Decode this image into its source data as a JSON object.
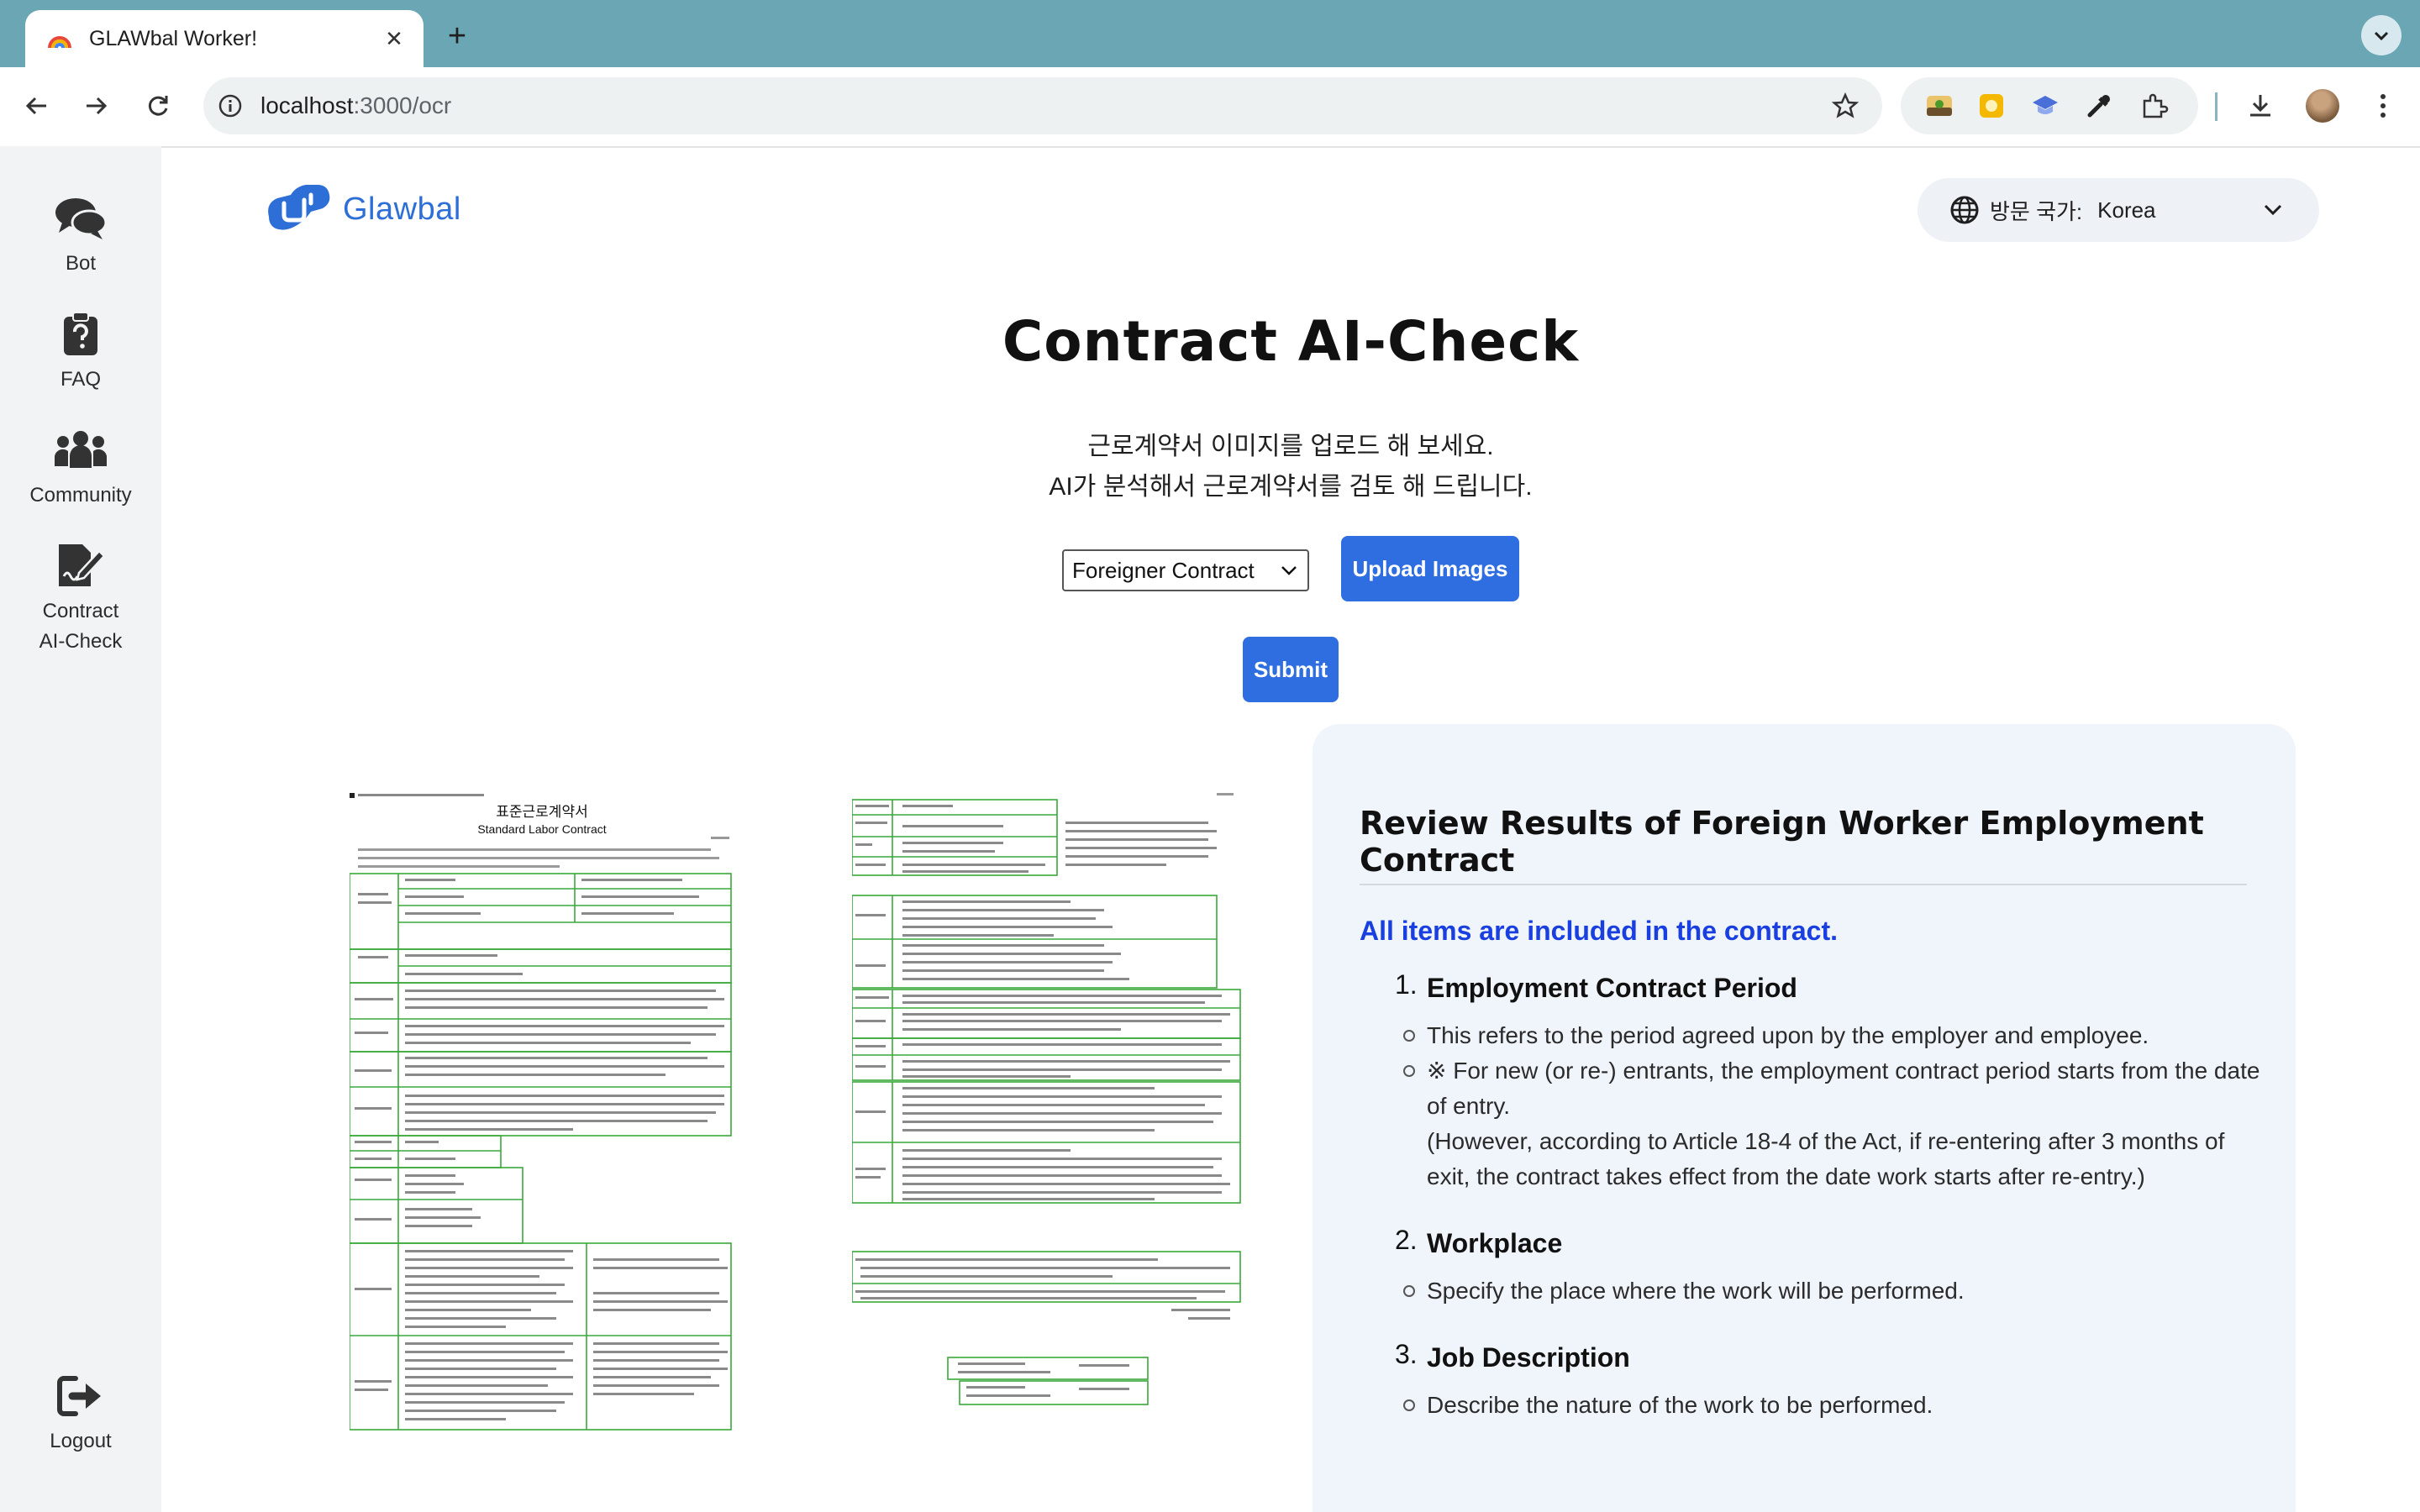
{
  "browser": {
    "tab_title": "GLAWbal Worker!",
    "url_host": "localhost",
    "url_path": ":3000/ocr"
  },
  "sidebar": {
    "items": [
      {
        "label": "Bot",
        "icon": "chat-bubbles-icon"
      },
      {
        "label": "FAQ",
        "icon": "question-clipboard-icon"
      },
      {
        "label": "Community",
        "icon": "people-group-icon"
      },
      {
        "label": "Contract",
        "label2": "AI-Check",
        "icon": "contract-pen-icon"
      }
    ],
    "logout_label": "Logout"
  },
  "header": {
    "logo_text": "Glawbal",
    "country_label": "방문 국가:",
    "country_value": "Korea"
  },
  "main": {
    "title": "Contract AI-Check",
    "subtitle_line1": "근로계약서 이미지를 업로드 해 보세요.",
    "subtitle_line2": "AI가 분석해서 근로계약서를 검토 해 드립니다.",
    "contract_type_selected": "Foreigner Contract",
    "upload_label": "Upload Images",
    "submit_label": "Submit"
  },
  "documents": {
    "doc1_heading_ko": "표준근로계약서",
    "doc1_heading_en": "Standard Labor Contract"
  },
  "results": {
    "title": "Review Results of Foreign Worker Employment Contract",
    "status": "All items are included in the contract.",
    "items": [
      {
        "num": "1.",
        "heading": "Employment Contract Period",
        "bullets": [
          "This refers to the period agreed upon by the employer and employee.",
          "※ For new (or re-) entrants, the employment contract period starts from the date of entry.",
          "(However, according to Article 18-4 of the Act, if re-entering after 3 months of exit, the contract takes effect from the date work starts after re-entry.)"
        ]
      },
      {
        "num": "2.",
        "heading": "Workplace",
        "bullets": [
          "Specify the place where the work will be performed."
        ]
      },
      {
        "num": "3.",
        "heading": "Job Description",
        "bullets": [
          "Describe the nature of the work to be performed."
        ]
      }
    ]
  },
  "colors": {
    "accent": "#2f6ee0",
    "status_blue": "#1a3fe0",
    "tabstrip": "#6aa6b3",
    "sidebar_bg": "#f1f3f5",
    "panel_bg": "#f0f5fc"
  }
}
